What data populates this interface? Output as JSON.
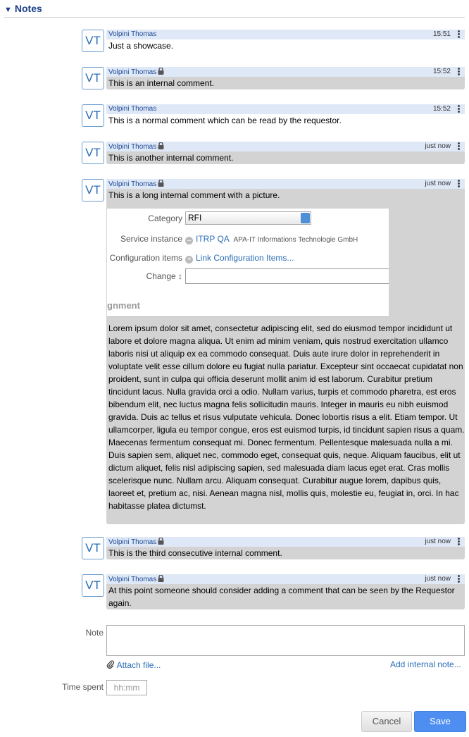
{
  "section": {
    "title": "Notes"
  },
  "notes": [
    {
      "initials": "VT",
      "author": "Volpini Thomas",
      "time": "15:51",
      "text": "Just a showcase."
    },
    {
      "initials": "VT",
      "author": "Volpini Thomas",
      "time": "15:52",
      "text": "This is an internal comment."
    },
    {
      "initials": "VT",
      "author": "Volpini Thomas",
      "time": "15:52",
      "text": "This is a normal comment which can be read by the requestor."
    },
    {
      "initials": "VT",
      "author": "Volpini Thomas",
      "time": "just now",
      "text": "This is another internal comment."
    },
    {
      "initials": "VT",
      "author": "Volpini Thomas",
      "time": "just now",
      "text": "This is a long internal comment with a picture.",
      "picture": {
        "category_label": "Category",
        "category_value": "RFI",
        "service_label": "Service instance",
        "service_value": "ITRP QA",
        "service_org": "APA-IT Informations Technologie GmbH",
        "ci_label": "Configuration items",
        "ci_link": "Link Configuration Items...",
        "change_label": "Change ↕",
        "section_fragment": "gnment"
      },
      "lorem": "Lorem ipsum dolor sit amet, consectetur adipiscing elit, sed do eiusmod tempor incididunt ut labore et dolore magna aliqua. Ut enim ad minim veniam, quis nostrud exercitation ullamco laboris nisi ut aliquip ex ea commodo consequat. Duis aute irure dolor in reprehenderit in voluptate velit esse cillum dolore eu fugiat nulla pariatur. Excepteur sint occaecat cupidatat non proident, sunt in culpa qui officia deserunt mollit anim id est laborum. Curabitur pretium tincidunt lacus. Nulla gravida orci a odio. Nullam varius, turpis et commodo pharetra, est eros bibendum elit, nec luctus magna felis sollicitudin mauris. Integer in mauris eu nibh euismod gravida. Duis ac tellus et risus vulputate vehicula. Donec lobortis risus a elit. Etiam tempor. Ut ullamcorper, ligula eu tempor congue, eros est euismod turpis, id tincidunt sapien risus a quam. Maecenas fermentum consequat mi. Donec fermentum. Pellentesque malesuada nulla a mi. Duis sapien sem, aliquet nec, commodo eget, consequat quis, neque. Aliquam faucibus, elit ut dictum aliquet, felis nisl adipiscing sapien, sed malesuada diam lacus eget erat. Cras mollis scelerisque nunc. Nullam arcu. Aliquam consequat. Curabitur augue lorem, dapibus quis, laoreet et, pretium ac, nisi. Aenean magna nisl, mollis quis, molestie eu, feugiat in, orci. In hac habitasse platea dictumst."
    },
    {
      "initials": "VT",
      "author": "Volpini Thomas",
      "time": "just now",
      "text": "This is the third consecutive internal comment."
    },
    {
      "initials": "VT",
      "author": "Volpini Thomas",
      "time": "just now",
      "text": "At this point someone should consider adding a comment that can be seen by the Requestor again."
    }
  ],
  "form": {
    "note_label": "Note",
    "attach_label": "Attach file...",
    "internal_note_label": "Add internal note...",
    "time_spent_label": "Time spent",
    "time_placeholder": "hh:mm",
    "cancel_label": "Cancel",
    "save_label": "Save"
  }
}
